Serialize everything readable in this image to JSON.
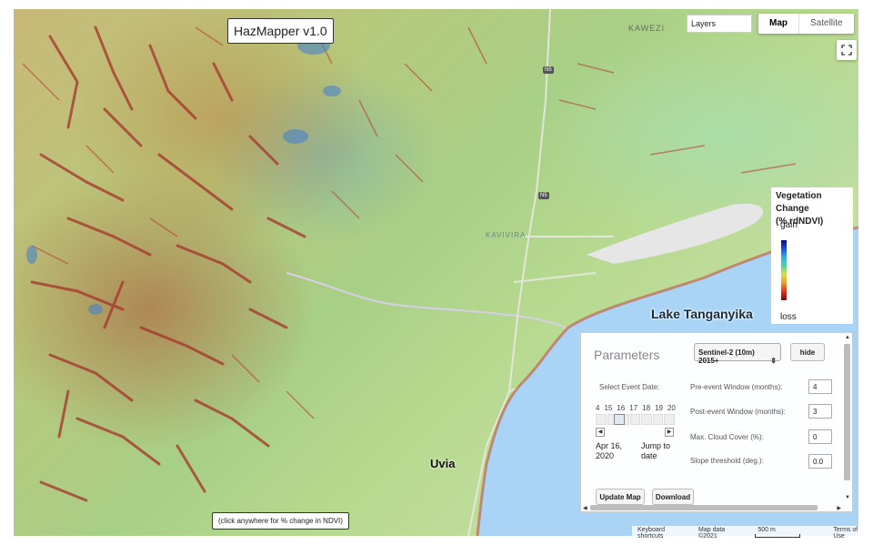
{
  "app": {
    "title": "HazMapper v1.0"
  },
  "map_controls": {
    "layers_label": "Layers",
    "map_type": {
      "map": "Map",
      "satellite": "Satellite",
      "selected": "Map"
    },
    "fullscreen_icon": "fullscreen-icon"
  },
  "legend": {
    "title_line1": "Vegetation Change",
    "title_line2": "(% rdNDVI)",
    "top_label": "gain",
    "bottom_label": "loss",
    "gradient": [
      "#0a0a7a",
      "#1f4fd8",
      "#2fb0e8",
      "#53d39a",
      "#d8e04a",
      "#f09a2a",
      "#d9331b",
      "#7a0a0a"
    ]
  },
  "places": {
    "lake": "Lake Tanganyika",
    "town": "Uvia",
    "kawezi": "KAWEZI",
    "kavivira": "KAVIVIRA",
    "road_n5": "N5"
  },
  "parameters": {
    "title": "Parameters",
    "sensor_select": "Sentinel-2 (10m) 2015+",
    "hide_label": "hide",
    "select_event_date_label": "Select Event Date:",
    "date_ticks": [
      "4",
      "15",
      "16",
      "17",
      "18",
      "19",
      "20"
    ],
    "selected_date": "Apr 16, 2020",
    "selected_date_line1": "Apr 16,",
    "selected_date_line2": "2020",
    "jump_line1": "Jump to",
    "jump_line2": "date",
    "pre_event_label": "Pre-event Window (months):",
    "pre_event_value": "4",
    "post_event_label": "Post-event Window (months):",
    "post_event_value": "3",
    "cloud_label": "Max. Cloud Cover (%):",
    "cloud_value": "0",
    "slope_label": "Slope threshold (deg.):",
    "slope_value": "0.0",
    "update_label": "Update Map",
    "download_label": "Download"
  },
  "hint": "(click anywhere for % change in NDVI)",
  "attribution": {
    "shortcuts": "Keyboard shortcuts",
    "map_data": "Map data ©2021",
    "scale": "500 m",
    "terms": "Terms of Use"
  },
  "colors": {
    "lake": "#a9d4f5",
    "terrain_loss": "#a0322a",
    "terrain_gain": "#3f7fd0"
  }
}
